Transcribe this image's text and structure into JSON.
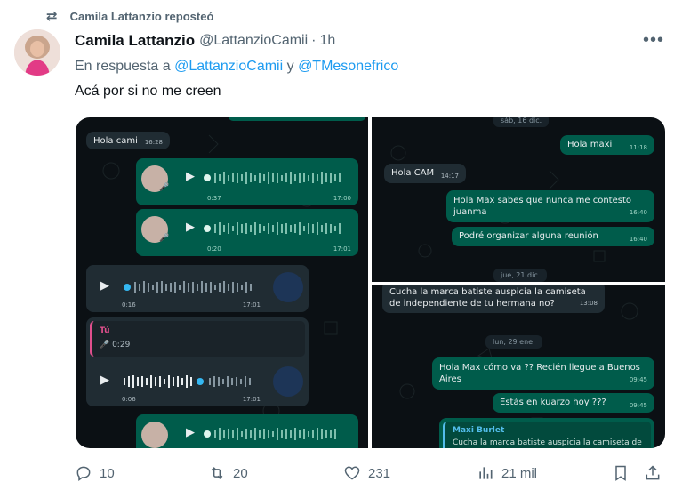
{
  "repost": {
    "label": "Camila Lattanzio reposteó"
  },
  "tweet": {
    "author_name": "Camila Lattanzio",
    "author_handle": "@LattanzioCamii",
    "time": "1h",
    "reply_prefix": "En respuesta a",
    "reply_user1": "@LattanzioCamii",
    "reply_join": "y",
    "reply_user2": "@TMesonefrico",
    "text": "Acá por si no me creen"
  },
  "chatA": {
    "msg1": {
      "text": "Hola cami",
      "time": "16:28"
    },
    "voice1": {
      "duration": "0:37",
      "time": "17:00"
    },
    "voice2": {
      "duration": "0:20",
      "time": "17:01"
    },
    "voice3": {
      "duration": "0:16",
      "time": "17:01"
    },
    "quote": {
      "author": "Tú",
      "duration": "0:29"
    },
    "voice4": {
      "duration": "0:06",
      "time": "17:01"
    }
  },
  "chatB": {
    "date1": "sáb, 16 dic.",
    "msg1": {
      "text": "Hola maxi",
      "time": "11:18"
    },
    "msg2": {
      "text": "Hola CAM",
      "time": "14:17"
    },
    "msg3": {
      "text": "Hola Max sabes que nunca me contesto juanma",
      "time": "16:40"
    },
    "msg4": {
      "text": "Podré organizar alguna reunión",
      "time": "16:40"
    },
    "date2": "jue, 21 dic."
  },
  "chatC": {
    "msg1": {
      "text": "Cucha la marca batiste auspicia la camiseta de independiente de tu hermana no?",
      "time": "13:08"
    },
    "date1": "lun, 29 ene.",
    "msg2": {
      "text": "Hola Max cómo va ?? Recién llegue a Buenos Aires",
      "time": "09:45"
    },
    "msg3": {
      "text": "Estás en kuarzo hoy ???",
      "time": "09:45"
    },
    "quote": {
      "author": "Maxi Burlet",
      "text": "Cucha la marca batiste auspicia la camiseta de"
    }
  },
  "actions": {
    "replies": "10",
    "reposts": "20",
    "likes": "231",
    "views": "21 mil"
  },
  "colors": {
    "accent": "#1d9bf0",
    "secondary_text": "#536471",
    "wa_out": "#005c4b",
    "wa_in": "#202c33",
    "wa_bg": "#0b1014"
  }
}
